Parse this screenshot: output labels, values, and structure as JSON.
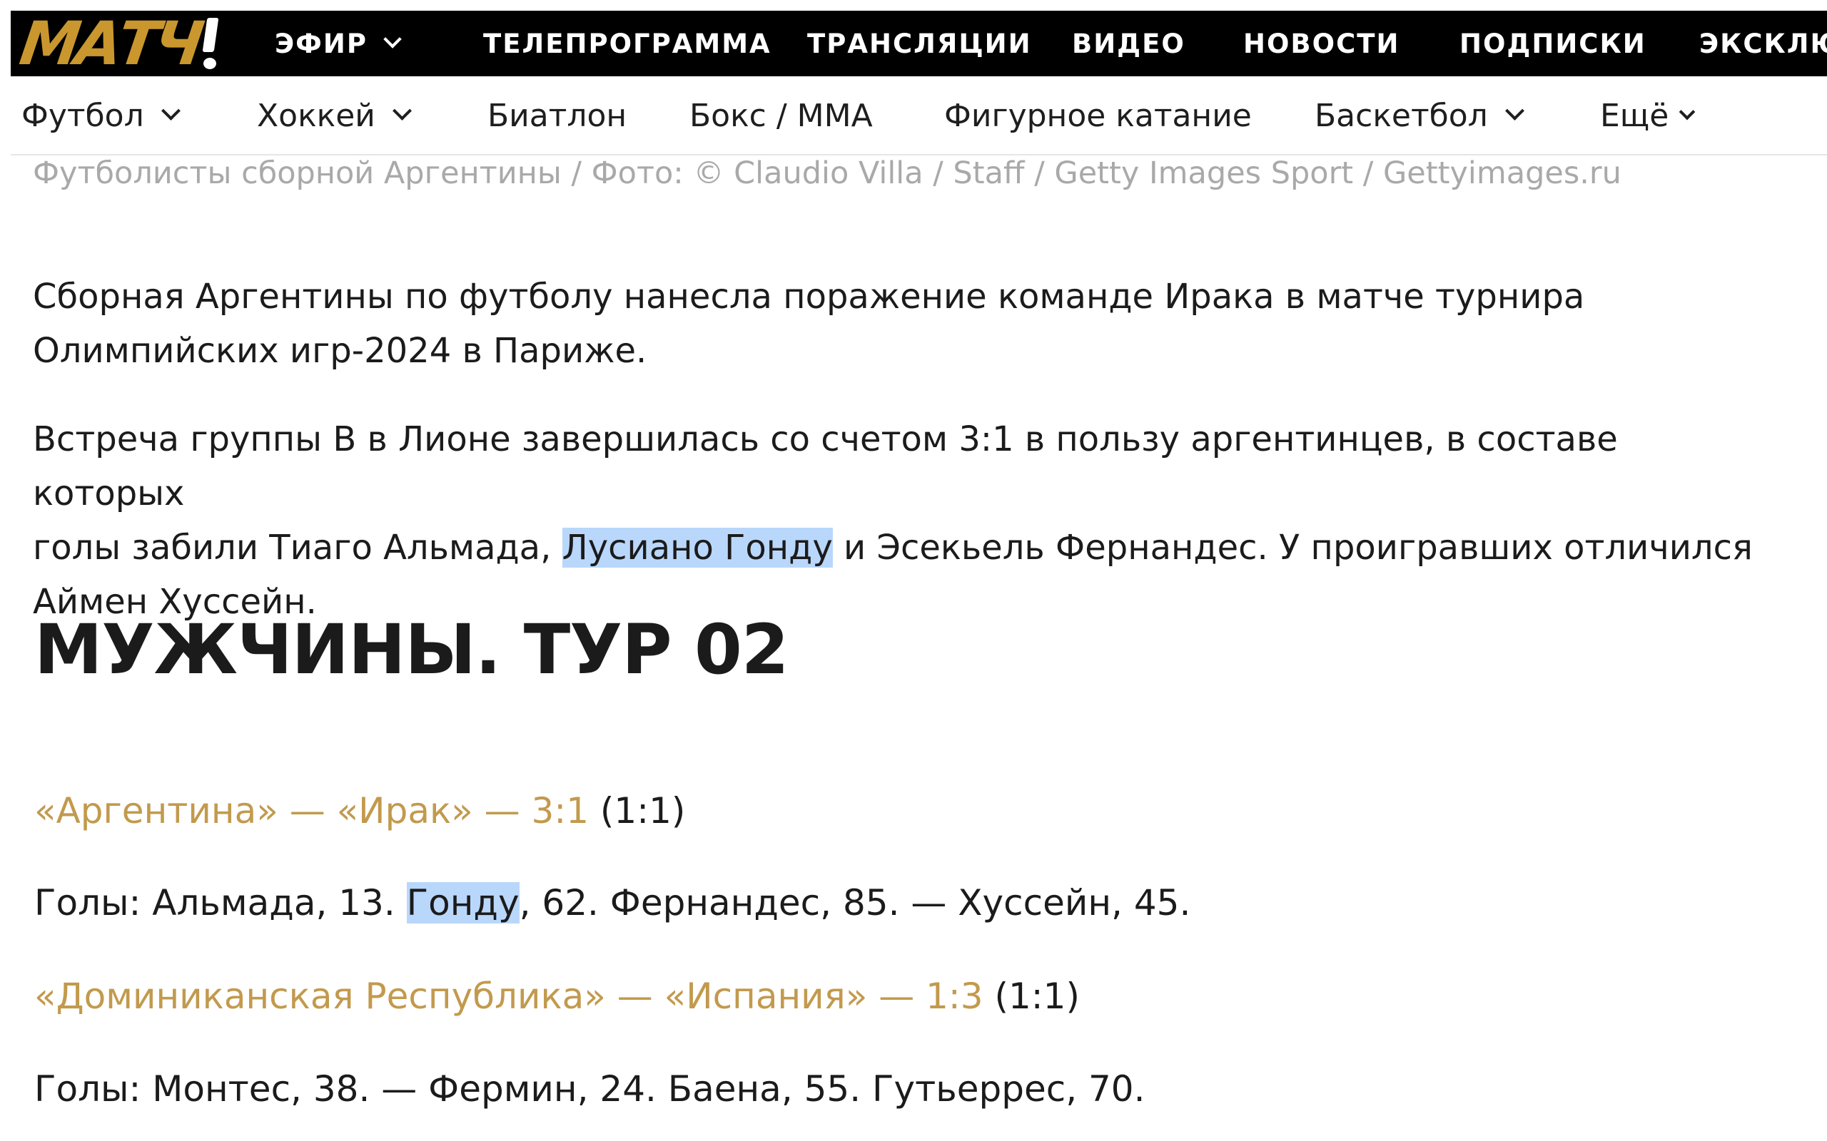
{
  "brand": {
    "logo_text": "МАТЧ",
    "logo_color": "#c9972e"
  },
  "top_nav": [
    {
      "label": "ЭФИР",
      "has_dropdown": true
    },
    {
      "label": "ТЕЛЕПРОГРАММА"
    },
    {
      "label": "ТРАНСЛЯЦИИ"
    },
    {
      "label": "ВИДЕО"
    },
    {
      "label": "НОВОСТИ"
    },
    {
      "label": "ПОДПИСКИ"
    },
    {
      "label": "ЭКСКЛЮЗ"
    }
  ],
  "sport_nav": [
    {
      "label": "Футбол",
      "has_dropdown": true
    },
    {
      "label": "Хоккей",
      "has_dropdown": true
    },
    {
      "label": "Биатлон"
    },
    {
      "label": "Бокс / ММА"
    },
    {
      "label": "Фигурное катание"
    },
    {
      "label": "Баскетбол",
      "has_dropdown": true
    },
    {
      "label": "Ещё",
      "has_dropdown": true
    }
  ],
  "photo_caption": "Футболисты сборной Аргентины / Фото: © Claudio Villa / Staff / Getty Images Sport / Gettyimages.ru",
  "article": {
    "p1_line1": "Сборная Аргентины по футболу нанесла поражение команде Ирака в матче турнира",
    "p1_line2": "Олимпийских игр-2024 в Париже.",
    "p2_line1": "Встреча группы B в Лионе завершилась со счетом 3:1 в пользу аргентинцев, в составе которых",
    "p2_line2_a": "голы забили Тиаго Альмада, ",
    "p2_line2_hl": "Лусиано Гонду",
    "p2_line2_b": " и Эсекьель Фернандес. У проигравших отличился",
    "p2_line3": "Аймен Хуссейн."
  },
  "section_heading": "МУЖЧИНЫ. ТУР 02",
  "matches": [
    {
      "link": "«Аргентина» — «Ирак» — 3:1",
      "halftime": " (1:1)",
      "goals_a": "Голы: Альмада, 13. ",
      "goals_hl": "Гонду",
      "goals_b": ", 62. Фернандес, 85. — Хуссейн, 45."
    },
    {
      "link": "«Доминиканская Республика» — «Испания» — 1:3",
      "halftime": " (1:1)",
      "goals_a": "Голы: Монтес, 38. — Фермин, 24. Баена, 55. Гутьеррес, 70.",
      "goals_hl": "",
      "goals_b": ""
    }
  ],
  "colors": {
    "accent_gold": "#c29a4d",
    "highlight": "#b9d7fb",
    "caption_gray": "#a9a9a9"
  }
}
